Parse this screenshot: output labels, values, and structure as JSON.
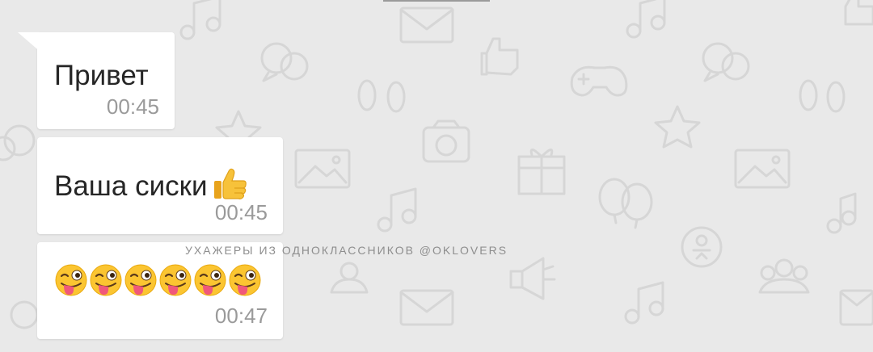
{
  "chat": {
    "watermark": "УХАЖЕРЫ ИЗ ОДНОКЛАССНИКОВ @OKLOVERS",
    "messages": [
      {
        "text": "Привет",
        "time": "00:45"
      },
      {
        "text": "Ваша сиски",
        "emoji": "thumbs-up-emoji",
        "time": "00:45"
      },
      {
        "emojis": [
          "winking-face-with-tongue-emoji",
          "winking-face-with-tongue-emoji",
          "winking-face-with-tongue-emoji",
          "winking-face-with-tongue-emoji",
          "winking-face-with-tongue-emoji",
          "winking-face-with-tongue-emoji"
        ],
        "time": "00:47"
      }
    ]
  },
  "colors": {
    "background": "#e9e9e9",
    "bubble": "#ffffff",
    "text": "#262626",
    "time": "#9a9a9a"
  }
}
